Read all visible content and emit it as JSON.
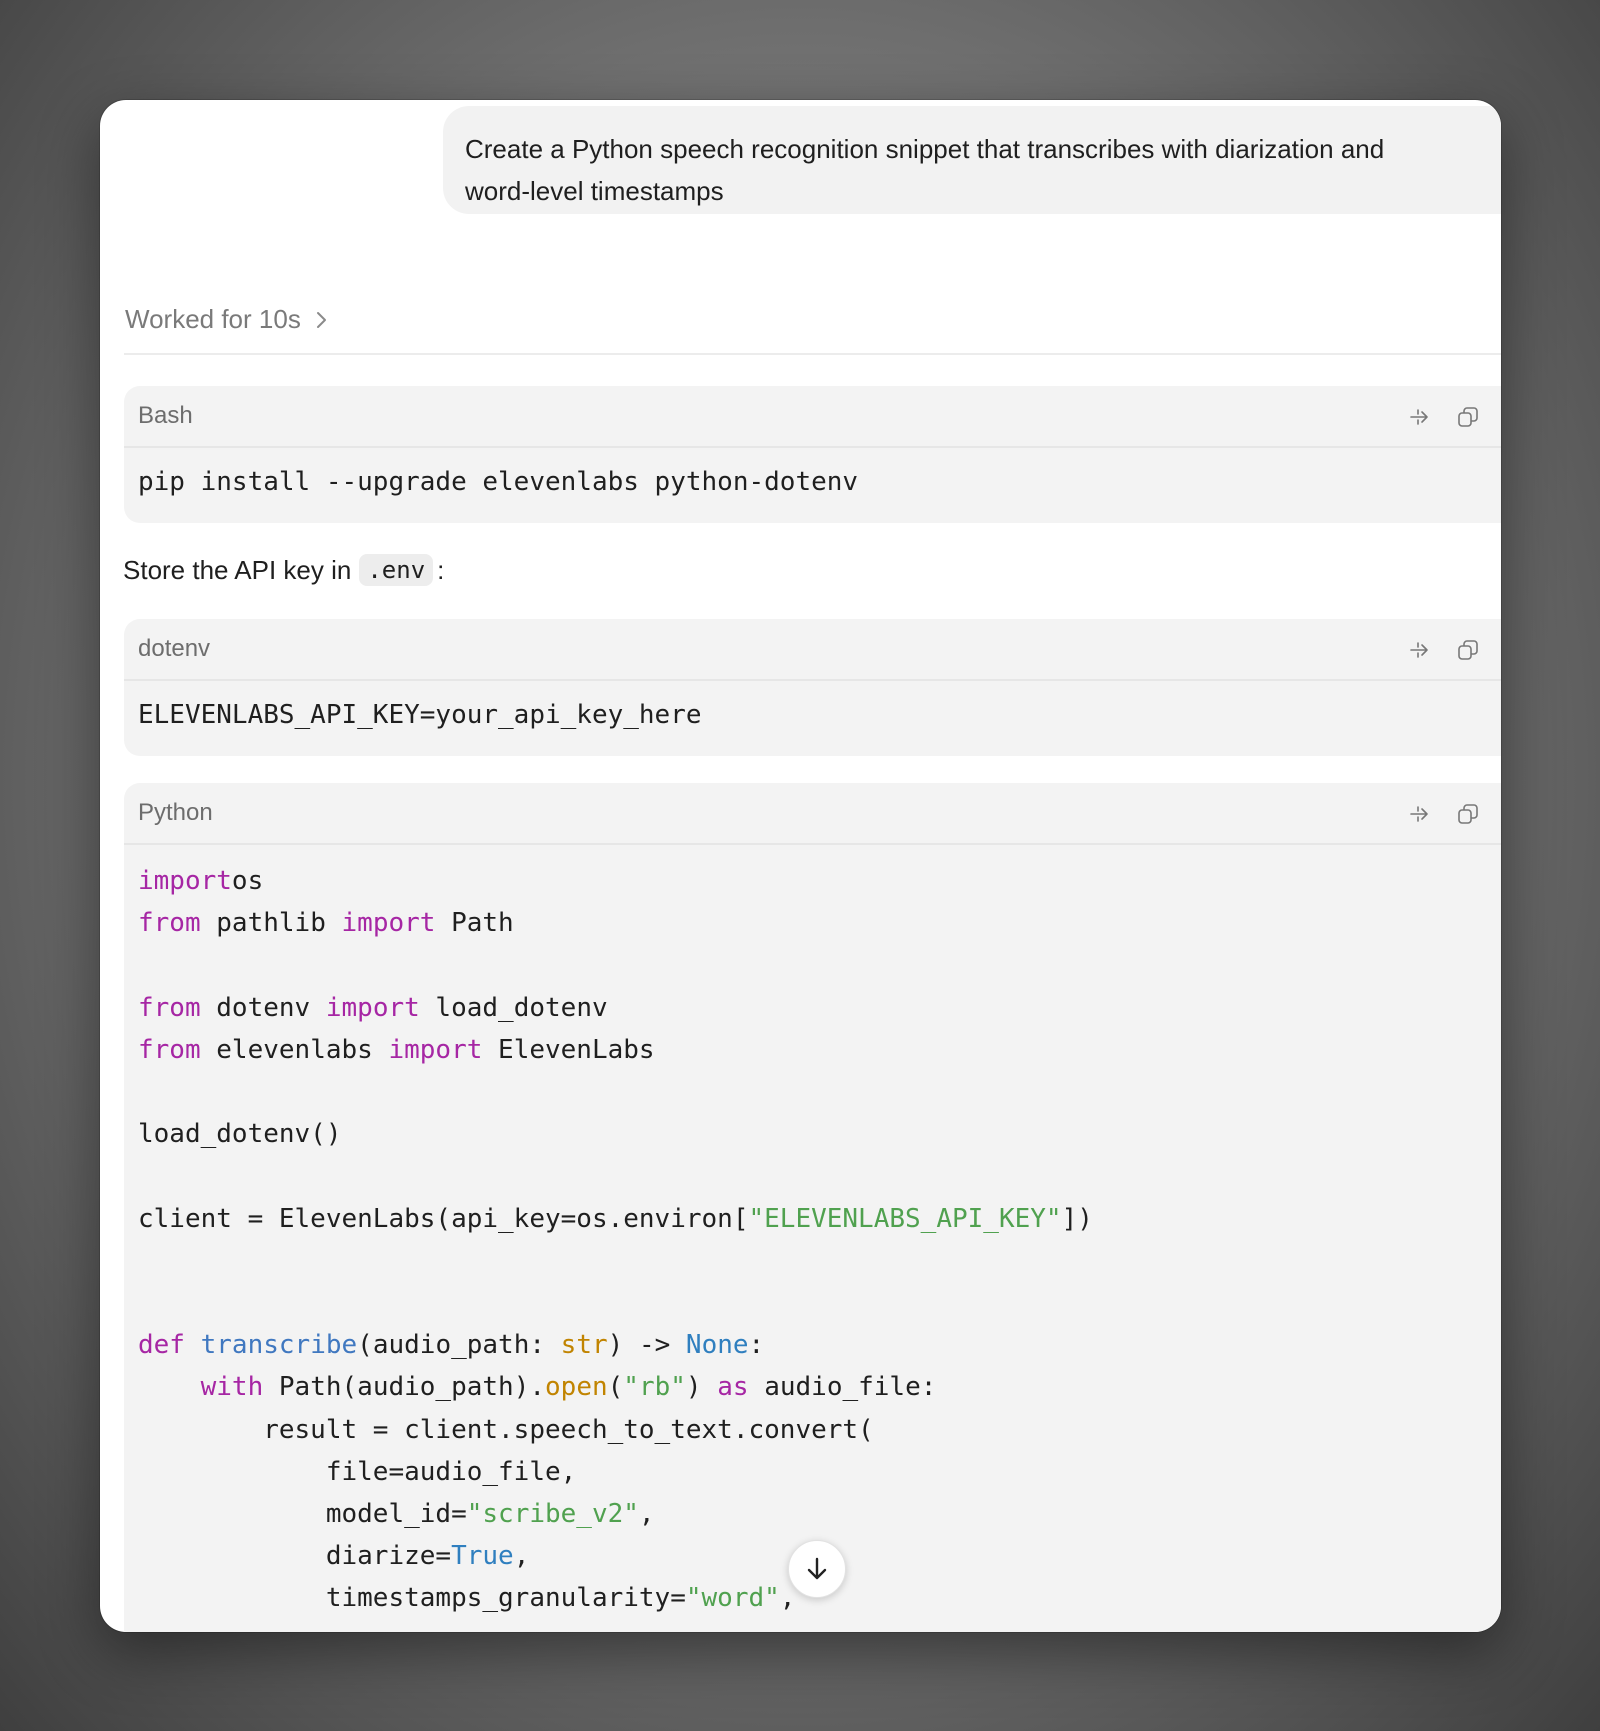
{
  "user_message": {
    "line1": "Create a Python speech recognition snippet that transcribes with diarization and",
    "line2": "word-level timestamps"
  },
  "worked": {
    "label": "Worked for 10s"
  },
  "blocks": {
    "bash": {
      "lang": "Bash",
      "code": "pip install --upgrade elevenlabs python-dotenv"
    },
    "prose": {
      "before": "Store the API key in",
      "code": ".env",
      "after": ":"
    },
    "dotenv": {
      "lang": "dotenv",
      "code": "ELEVENLABS_API_KEY=your_api_key_here"
    },
    "python": {
      "lang": "Python",
      "lines": [
        [
          [
            "kw",
            "import"
          ],
          [
            "",
            "os"
          ]
        ],
        [
          [
            "kw",
            "from"
          ],
          [
            "",
            " pathlib "
          ],
          [
            "kw",
            "import"
          ],
          [
            "",
            " Path"
          ]
        ],
        [],
        [
          [
            "kw",
            "from"
          ],
          [
            "",
            " dotenv "
          ],
          [
            "kw",
            "import"
          ],
          [
            "",
            " load_dotenv"
          ]
        ],
        [
          [
            "kw",
            "from"
          ],
          [
            "",
            " elevenlabs "
          ],
          [
            "kw",
            "import"
          ],
          [
            "",
            " ElevenLabs"
          ]
        ],
        [],
        [
          [
            "",
            "load_dotenv()"
          ]
        ],
        [],
        [
          [
            "",
            "client = ElevenLabs(api_key=os.environ["
          ],
          [
            "st",
            "\"ELEVENLABS_API_KEY\""
          ],
          [
            "",
            "])"
          ]
        ],
        [],
        [],
        [
          [
            "kw",
            "def"
          ],
          [
            "",
            " "
          ],
          [
            "fn",
            "transcribe"
          ],
          [
            "",
            "(audio_path: "
          ],
          [
            "bi",
            "str"
          ],
          [
            "",
            ") -> "
          ],
          [
            "cn",
            "None"
          ],
          [
            "",
            ":"
          ]
        ],
        [
          [
            "",
            "    "
          ],
          [
            "kw",
            "with"
          ],
          [
            "",
            " Path(audio_path)."
          ],
          [
            "bi",
            "open"
          ],
          [
            "",
            "("
          ],
          [
            "st",
            "\"rb\""
          ],
          [
            "",
            ") "
          ],
          [
            "kw",
            "as"
          ],
          [
            "",
            " audio_file:"
          ]
        ],
        [
          [
            "",
            "        result = client.speech_to_text.convert("
          ]
        ],
        [
          [
            "",
            "            file=audio_file,"
          ]
        ],
        [
          [
            "",
            "            model_id="
          ],
          [
            "st",
            "\"scribe_v2\""
          ],
          [
            "",
            ","
          ]
        ],
        [
          [
            "",
            "            diarize="
          ],
          [
            "cn",
            "True"
          ],
          [
            "",
            ","
          ]
        ],
        [
          [
            "",
            "            timestamps_granularity="
          ],
          [
            "st",
            "\"word\""
          ],
          [
            "",
            ","
          ]
        ]
      ]
    }
  },
  "icons": {
    "action_1": "insert-arrow-icon",
    "action_2": "copy-icon",
    "scroll": "arrow-down-icon",
    "chevron": "chevron-right-icon"
  },
  "colors": {
    "keyword": "#a626a4",
    "function": "#4078c0",
    "builtin": "#c18401",
    "string": "#50a14f",
    "constant": "#2f7fbf"
  }
}
